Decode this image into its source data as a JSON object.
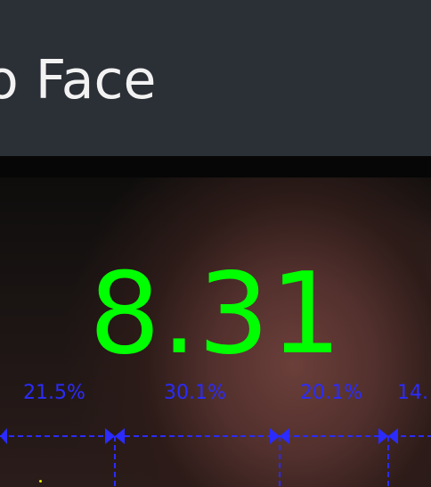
{
  "app_bar": {
    "title": "o Face"
  },
  "score": {
    "value": "8.31"
  },
  "proportions": [
    "21.5%",
    "30.1%",
    "20.1%",
    "14."
  ],
  "colors": {
    "score": "#00ff00",
    "guides": "#2b2bff",
    "app_bar": "#2b2f36"
  }
}
